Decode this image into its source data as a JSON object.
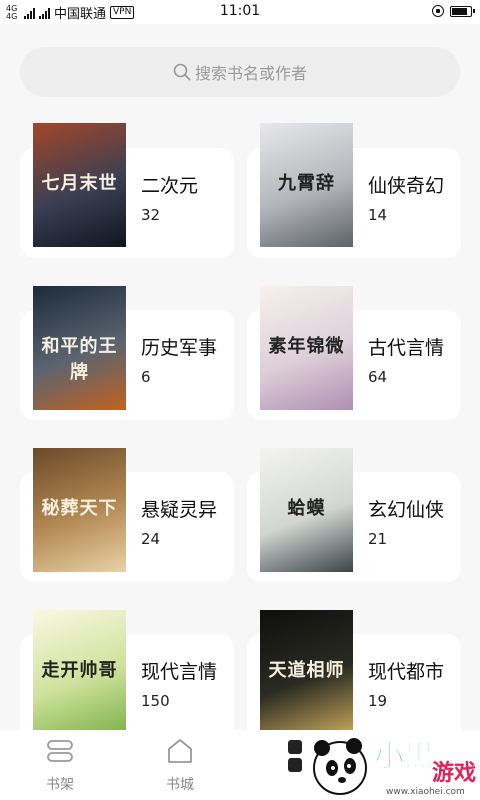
{
  "status_bar": {
    "network": "4G 4G",
    "carrier": "中国联通",
    "vpn": "VPN",
    "time": "11:01",
    "battery_level": 0.85
  },
  "search": {
    "placeholder": "搜索书名或作者",
    "icon": "search-icon"
  },
  "categories": [
    {
      "name": "二次元",
      "count": "32",
      "cover_title": "七月末世",
      "cover_colors": [
        "#a4462a",
        "#3a3f52",
        "#121621"
      ]
    },
    {
      "name": "仙侠奇幻",
      "count": "14",
      "cover_title": "九霄辞",
      "cover_colors": [
        "#e8e8ea",
        "#b3b6bb",
        "#5d6269"
      ]
    },
    {
      "name": "历史军事",
      "count": "6",
      "cover_title": "和平的王牌",
      "cover_colors": [
        "#1c2b3a",
        "#5b6470",
        "#c2621f"
      ]
    },
    {
      "name": "古代言情",
      "count": "64",
      "cover_title": "素年锦微",
      "cover_colors": [
        "#f6f1ee",
        "#ddd0d8",
        "#b08fb2"
      ]
    },
    {
      "name": "悬疑灵异",
      "count": "24",
      "cover_title": "秘葬天下",
      "cover_colors": [
        "#6b4a2a",
        "#b48a55",
        "#e8d2a6"
      ]
    },
    {
      "name": "玄幻仙侠",
      "count": "21",
      "cover_title": "蛤蟆",
      "cover_colors": [
        "#f4f4f2",
        "#d2d6d2",
        "#3b4448"
      ]
    },
    {
      "name": "现代言情",
      "count": "150",
      "cover_title": "走开帅哥",
      "cover_colors": [
        "#fbf8e2",
        "#cfe29c",
        "#7fb24b"
      ]
    },
    {
      "name": "现代都市",
      "count": "19",
      "cover_title": "天道相师",
      "cover_colors": [
        "#0e0f0e",
        "#2a2b22",
        "#c7a75b"
      ]
    }
  ],
  "bottom_nav": [
    {
      "label": "书架",
      "icon": "bookshelf-icon"
    },
    {
      "label": "书城",
      "icon": "home-icon"
    }
  ],
  "watermark": {
    "text": "游戏",
    "subtext": "www.xiaohei.com"
  }
}
